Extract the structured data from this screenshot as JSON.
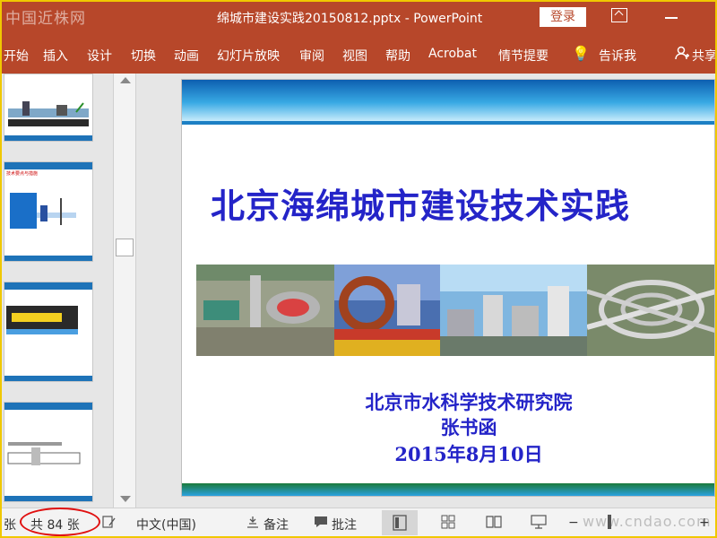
{
  "titlebar": {
    "watermark": "中国近株网",
    "title": "绵城市建设实践20150812.pptx - PowerPoint",
    "login_label": "登录"
  },
  "ribbon": {
    "tabs": [
      "开始",
      "插入",
      "设计",
      "切换",
      "动画",
      "幻灯片放映",
      "审阅",
      "视图",
      "帮助",
      "Acrobat",
      "情节提要"
    ],
    "tell_me": "告诉我",
    "share": "共享"
  },
  "slide": {
    "headline": "北京海绵城市建设技术实践",
    "organization": "北京市水科学技术研究院",
    "author": "张书函",
    "date": "2015年8月10日"
  },
  "status": {
    "slide_prefix": "张",
    "slide_count": "共 84 张",
    "language": "中文(中国)",
    "notes": "备注",
    "comments": "批注",
    "watermark": "www.cndao.com"
  },
  "colors": {
    "accent": "#b7472a",
    "headline": "#2424c8",
    "highlight_circle": "#e01010"
  }
}
